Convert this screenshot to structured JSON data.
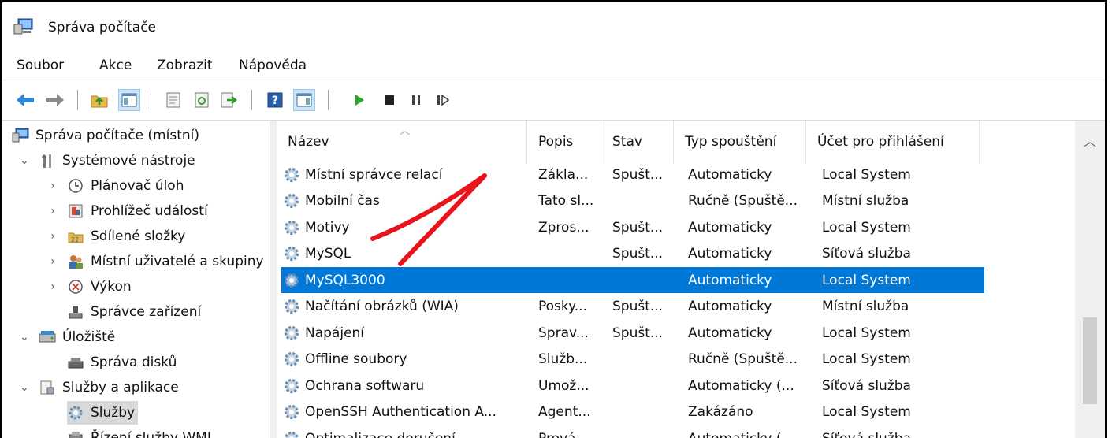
{
  "window": {
    "title": "Správa počítače",
    "icon": "computer-management-icon"
  },
  "menu": [
    {
      "label": "Soubor"
    },
    {
      "label": "Akce"
    },
    {
      "label": "Zobrazit"
    },
    {
      "label": "Nápověda"
    }
  ],
  "toolbar": {
    "buttons": [
      "back-arrow-icon",
      "forward-arrow-icon",
      "up-folder-icon",
      "show-hide-console-tree-icon",
      "properties-icon",
      "refresh-icon",
      "export-list-icon",
      "help-icon",
      "show-hide-action-pane-icon",
      "start-service-icon",
      "stop-service-icon",
      "pause-service-icon",
      "restart-service-icon"
    ]
  },
  "tree": [
    {
      "label": "Správa počítače (místní)",
      "icon": "computer-management-icon"
    },
    {
      "label": "Systémové nástroje",
      "icon": "tools-icon",
      "expanded": true
    },
    {
      "label": "Plánovač úloh",
      "icon": "clock-icon"
    },
    {
      "label": "Prohlížeč událostí",
      "icon": "event-viewer-icon"
    },
    {
      "label": "Sdílené složky",
      "icon": "shared-folder-icon"
    },
    {
      "label": "Místní uživatelé a skupiny",
      "icon": "users-icon"
    },
    {
      "label": "Výkon",
      "icon": "performance-icon"
    },
    {
      "label": "Správce zařízení",
      "icon": "device-manager-icon"
    },
    {
      "label": "Úložiště",
      "icon": "storage-icon",
      "expanded": true
    },
    {
      "label": "Správa disků",
      "icon": "disk-management-icon"
    },
    {
      "label": "Služby a aplikace",
      "icon": "services-apps-icon",
      "expanded": true
    },
    {
      "label": "Služby",
      "icon": "services-gear-icon",
      "selected": true
    },
    {
      "label": "Řízení služby WMI",
      "icon": "wmi-icon"
    }
  ],
  "list": {
    "columns": [
      "Název",
      "Popis",
      "Stav",
      "Typ spouštění",
      "Účet pro přihlášení"
    ],
    "rows": [
      {
        "name": "Místní správce relací",
        "description": "Zákla...",
        "status": "Spušt...",
        "startup": "Automaticky",
        "account": "Local System"
      },
      {
        "name": "Mobilní čas",
        "description": "Tato sl...",
        "status": "",
        "startup": "Ručně (Spuště...",
        "account": "Místní služba"
      },
      {
        "name": "Motivy",
        "description": "Zpros...",
        "status": "Spušt...",
        "startup": "Automaticky",
        "account": "Local System"
      },
      {
        "name": "MySQL",
        "description": "",
        "status": "Spušt...",
        "startup": "Automaticky",
        "account": "Síťová služba"
      },
      {
        "name": "MySQL3000",
        "description": "",
        "status": "",
        "startup": "Automaticky",
        "account": "Local System",
        "selected": true
      },
      {
        "name": "Načítání obrázků (WIA)",
        "description": "Posky...",
        "status": "Spušt...",
        "startup": "Automaticky",
        "account": "Místní služba"
      },
      {
        "name": "Napájení",
        "description": "Sprav...",
        "status": "Spušt...",
        "startup": "Automaticky",
        "account": "Local System"
      },
      {
        "name": "Offline soubory",
        "description": "Služb...",
        "status": "",
        "startup": "Ručně (Spuště...",
        "account": "Local System"
      },
      {
        "name": "Ochrana softwaru",
        "description": "Umož...",
        "status": "",
        "startup": "Automaticky (...",
        "account": "Síťová služba"
      },
      {
        "name": "OpenSSH Authentication A...",
        "description": "Agent...",
        "status": "",
        "startup": "Zakázáno",
        "account": "Local System"
      },
      {
        "name": "Optimalizace doručení",
        "description": "Prová...",
        "status": "",
        "startup": "Automaticky (...",
        "account": "Síťová služba"
      }
    ]
  },
  "colors": {
    "selection": "#0078d7",
    "annotation": "#e8141c",
    "tree_selection": "#d9d9d9"
  }
}
